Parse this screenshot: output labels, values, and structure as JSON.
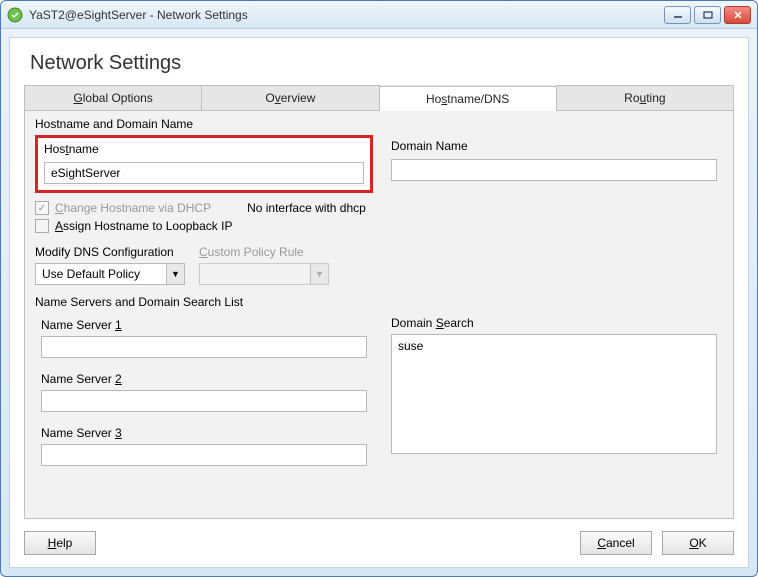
{
  "window": {
    "title": "YaST2@eSightServer - Network Settings"
  },
  "page_title": "Network Settings",
  "tabs": {
    "global": "Global Options",
    "overview": "Overview",
    "hostname": "Hostname/DNS",
    "routing": "Routing"
  },
  "hostname_section": {
    "heading": "Hostname and Domain Name",
    "hostname_label": "Hostname",
    "hostname_value": "eSightServer",
    "domain_label": "Domain Name",
    "domain_value": "",
    "change_dhcp_label": "Change Hostname via DHCP",
    "no_iface_text": "No interface with dhcp",
    "assign_loopback_label": "Assign Hostname to Loopback IP"
  },
  "dns_config": {
    "modify_label": "Modify DNS Configuration",
    "modify_value": "Use Default Policy",
    "custom_label": "Custom Policy Rule",
    "custom_value": ""
  },
  "ns_section": {
    "heading": "Name Servers and Domain Search List",
    "ns1_label": "Name Server 1",
    "ns1_value": "",
    "ns2_label": "Name Server 2",
    "ns2_value": "",
    "ns3_label": "Name Server 3",
    "ns3_value": "",
    "search_label": "Domain Search",
    "search_value": "suse"
  },
  "footer": {
    "help": "Help",
    "cancel": "Cancel",
    "ok": "OK"
  }
}
